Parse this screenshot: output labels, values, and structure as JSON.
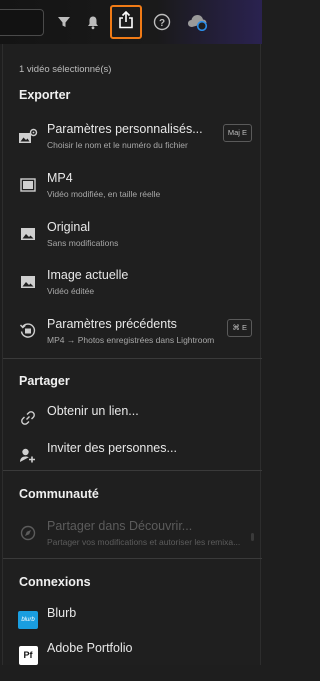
{
  "toolbar": {
    "icons": [
      "filter-icon",
      "bell-icon",
      "share-icon",
      "help-icon",
      "cloud-sync-icon"
    ]
  },
  "panel": {
    "selected_count": "1 vidéo sélectionné(s)",
    "export": {
      "title": "Exporter",
      "items": [
        {
          "label": "Paramètres personnalisés...",
          "sub": "Choisir le nom et le numéro du fichier",
          "shortcut": "Maj E",
          "icon": "custom-settings-icon"
        },
        {
          "label": "MP4",
          "sub": "Vidéo modifiée, en taille réelle",
          "icon": "video-frame-icon"
        },
        {
          "label": "Original",
          "sub": "Sans modifications",
          "icon": "image-icon"
        },
        {
          "label": "Image actuelle",
          "sub": "Vidéo éditée",
          "icon": "image-icon"
        },
        {
          "label": "Paramètres précédents",
          "sub": "MP4 → Photos enregistrées dans Lightroom",
          "shortcut": "⌘ E",
          "icon": "previous-settings-icon"
        }
      ]
    },
    "share": {
      "title": "Partager",
      "items": [
        {
          "label": "Obtenir un lien...",
          "icon": "link-icon"
        },
        {
          "label": "Inviter des personnes...",
          "icon": "invite-person-icon"
        }
      ]
    },
    "community": {
      "title": "Communauté",
      "items": [
        {
          "label": "Partager dans Découvrir...",
          "sub": "Partager vos modifications et autoriser les remixa...",
          "icon": "discover-icon",
          "disabled": true
        }
      ]
    },
    "connections": {
      "title": "Connexions",
      "items": [
        {
          "label": "Blurb",
          "logo_text": "blurb",
          "icon": "blurb-logo"
        },
        {
          "label": "Adobe Portfolio",
          "logo_text": "Pf",
          "icon": "adobe-portfolio-logo"
        }
      ]
    }
  },
  "colors": {
    "accent_outline": "#f07b16",
    "panel_bg": "#1f1f1f",
    "blurb_blue": "#1a9ee0"
  }
}
